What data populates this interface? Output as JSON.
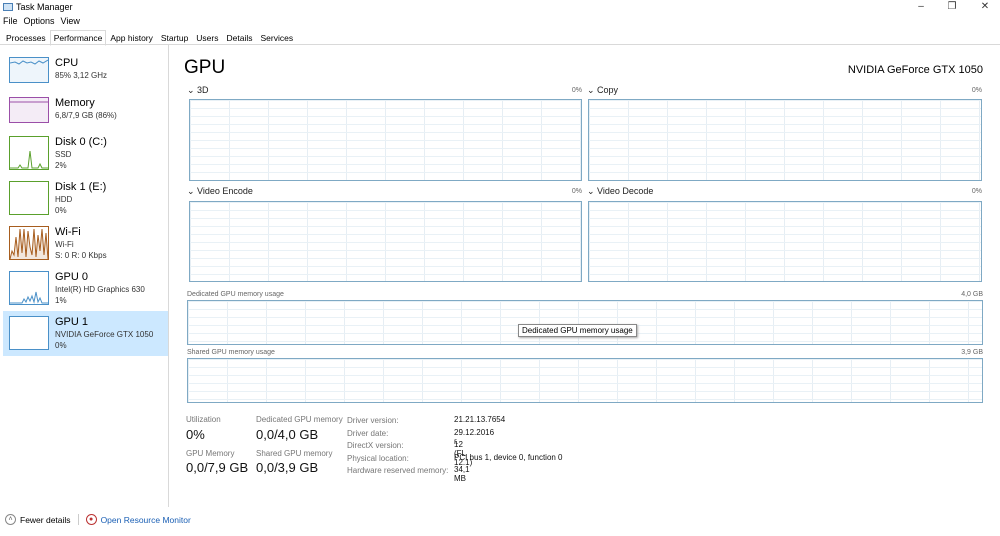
{
  "window": {
    "title": "Task Manager",
    "controls": [
      "minimize",
      "maximize",
      "close"
    ]
  },
  "menu": [
    "File",
    "Options",
    "View"
  ],
  "tabs": [
    {
      "label": "Processes"
    },
    {
      "label": "Performance",
      "active": true
    },
    {
      "label": "App history"
    },
    {
      "label": "Startup"
    },
    {
      "label": "Users"
    },
    {
      "label": "Details"
    },
    {
      "label": "Services"
    }
  ],
  "sidebar": [
    {
      "name": "CPU",
      "sub1": "85% 3,12 GHz",
      "color": "#4a90c8"
    },
    {
      "name": "Memory",
      "sub1": "6,8/7,9 GB (86%)",
      "color": "#9b4fa8"
    },
    {
      "name": "Disk 0 (C:)",
      "sub1": "SSD",
      "sub2": "2%",
      "color": "#5aa02c"
    },
    {
      "name": "Disk 1 (E:)",
      "sub1": "HDD",
      "sub2": "0%",
      "color": "#5aa02c"
    },
    {
      "name": "Wi-Fi",
      "sub1": "Wi-Fi",
      "sub2": "S: 0 R: 0 Kbps",
      "color": "#a75d1e"
    },
    {
      "name": "GPU 0",
      "sub1": "Intel(R) HD Graphics 630",
      "sub2": "1%",
      "color": "#4a90c8"
    },
    {
      "name": "GPU 1",
      "sub1": "NVIDIA GeForce GTX 1050",
      "sub2": "0%",
      "color": "#4a90c8",
      "selected": true
    }
  ],
  "main": {
    "title": "GPU",
    "device": "NVIDIA GeForce GTX 1050",
    "engines": [
      {
        "label": "3D",
        "pct": "0%"
      },
      {
        "label": "Copy",
        "pct": "0%"
      },
      {
        "label": "Video Encode",
        "pct": "0%"
      },
      {
        "label": "Video Decode",
        "pct": "0%"
      }
    ],
    "dedicated": {
      "label": "Dedicated GPU memory usage",
      "max": "4,0 GB",
      "tooltip": "Dedicated GPU memory usage"
    },
    "shared": {
      "label": "Shared GPU memory usage",
      "max": "3,9 GB"
    },
    "stats": {
      "utilization": {
        "label": "Utilization",
        "value": "0%"
      },
      "dedicated": {
        "label": "Dedicated GPU memory",
        "value": "0,0/4,0 GB"
      },
      "gpu_memory": {
        "label": "GPU Memory",
        "value": "0,0/7,9 GB"
      },
      "shared": {
        "label": "Shared GPU memory",
        "value": "0,0/3,9 GB"
      }
    },
    "details": [
      {
        "label": "Driver version:",
        "value": "21.21.13.7654"
      },
      {
        "label": "Driver date:",
        "value": "29.12.2016 г."
      },
      {
        "label": "DirectX version:",
        "value": "12 (FL 12.1)"
      },
      {
        "label": "Physical location:",
        "value": "PCI bus 1, device 0, function 0"
      },
      {
        "label": "Hardware reserved memory:",
        "value": "34,1 MB"
      }
    ]
  },
  "footer": {
    "fewer_details": "Fewer details",
    "resource_monitor": "Open Resource Monitor"
  }
}
